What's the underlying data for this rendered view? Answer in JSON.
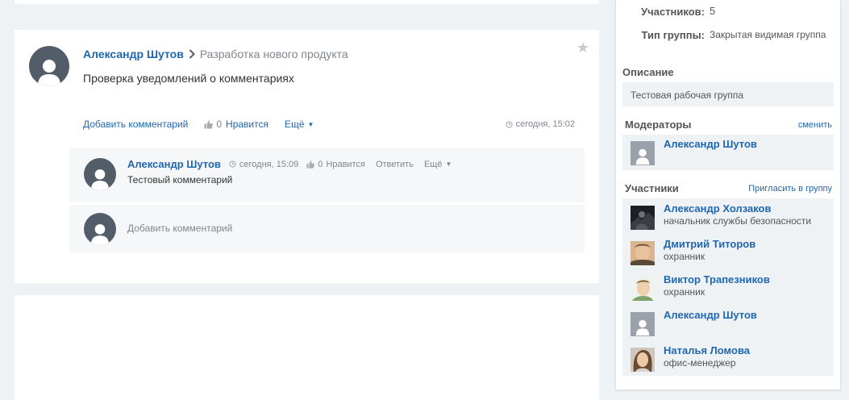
{
  "post": {
    "author": "Александр Шутов",
    "group": "Разработка нового продукта",
    "text": "Проверка уведомлений о комментариях",
    "add_comment": "Добавить комментарий",
    "like_count": "0",
    "like_label": "Нравится",
    "more_label": "Ещё",
    "time": "сегодня, 15:02"
  },
  "comment": {
    "author": "Александр Шутов",
    "time": "сегодня, 15:09",
    "like_count": "0",
    "like_label": "Нравится",
    "reply_label": "Ответить",
    "more_label": "Ещё",
    "text": "Тестовый комментарий"
  },
  "add_comment_placeholder": "Добавить комментарий",
  "side": {
    "members_count_label": "Участников:",
    "members_count": "5",
    "group_type_label": "Тип группы:",
    "group_type": "Закрытая видимая группа",
    "description_title": "Описание",
    "description": "Тестовая рабочая группа",
    "moderators_title": "Модераторы",
    "moderators_link": "сменить",
    "moderators": [
      {
        "name": "Александр Шутов",
        "role": ""
      }
    ],
    "members_title": "Участники",
    "members_link": "Пригласить в группу",
    "members": [
      {
        "name": "Александр Холзаков",
        "role": "начальник службы безопасности"
      },
      {
        "name": "Дмитрий Титоров",
        "role": "охранник"
      },
      {
        "name": "Виктор Трапезников",
        "role": "охранник"
      },
      {
        "name": "Александр Шутов",
        "role": ""
      },
      {
        "name": "Наталья Ломова",
        "role": "офис-менеджер"
      }
    ]
  },
  "colors": {
    "accent": "#2067b0",
    "avatar": "#535c69",
    "background": "#eef2f4"
  }
}
